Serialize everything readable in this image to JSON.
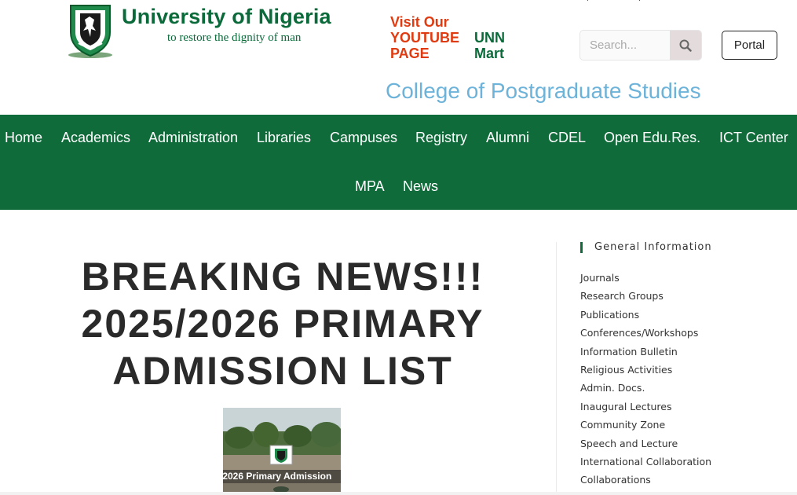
{
  "header": {
    "site_title": "University of Nigeria",
    "tagline": "to restore the dignity of man",
    "youtube_link": "Visit Our YOUTUBE PAGE",
    "mart_link": "UNN Mart",
    "search": {
      "placeholder": "Search..."
    },
    "portal_label": "Portal",
    "college_title": "College of Postgraduate Studies"
  },
  "nav": {
    "row1": [
      "Home",
      "Academics",
      "Administration",
      "Libraries",
      "Campuses",
      "Registry",
      "Alumni",
      "CDEL",
      "Open Edu.Res.",
      "ICT Center"
    ],
    "row2": [
      "MPA",
      "News"
    ]
  },
  "main": {
    "headline": "BREAKING NEWS!!! 2025/2026 PRIMARY ADMISSION LIST",
    "image_caption": "/2026 Primary Admission"
  },
  "sidebar": {
    "heading": "General Information",
    "items": [
      "Journals",
      "Research Groups",
      "Publications",
      "Conferences/Workshops",
      "Information Bulletin",
      "Religious Activities",
      "Admin. Docs.",
      "Inaugural Lectures",
      "Community Zone",
      "Speech and Lecture",
      "International Collaboration",
      "Collaborations"
    ]
  },
  "colors": {
    "brand_green": "#0f6b3a",
    "youtube_red": "#e03a10",
    "college_blue": "#6db3d9",
    "headline_dark": "#2a2a2a"
  },
  "icons": {
    "logo": "unn-crest-logo",
    "search": "search-icon"
  }
}
